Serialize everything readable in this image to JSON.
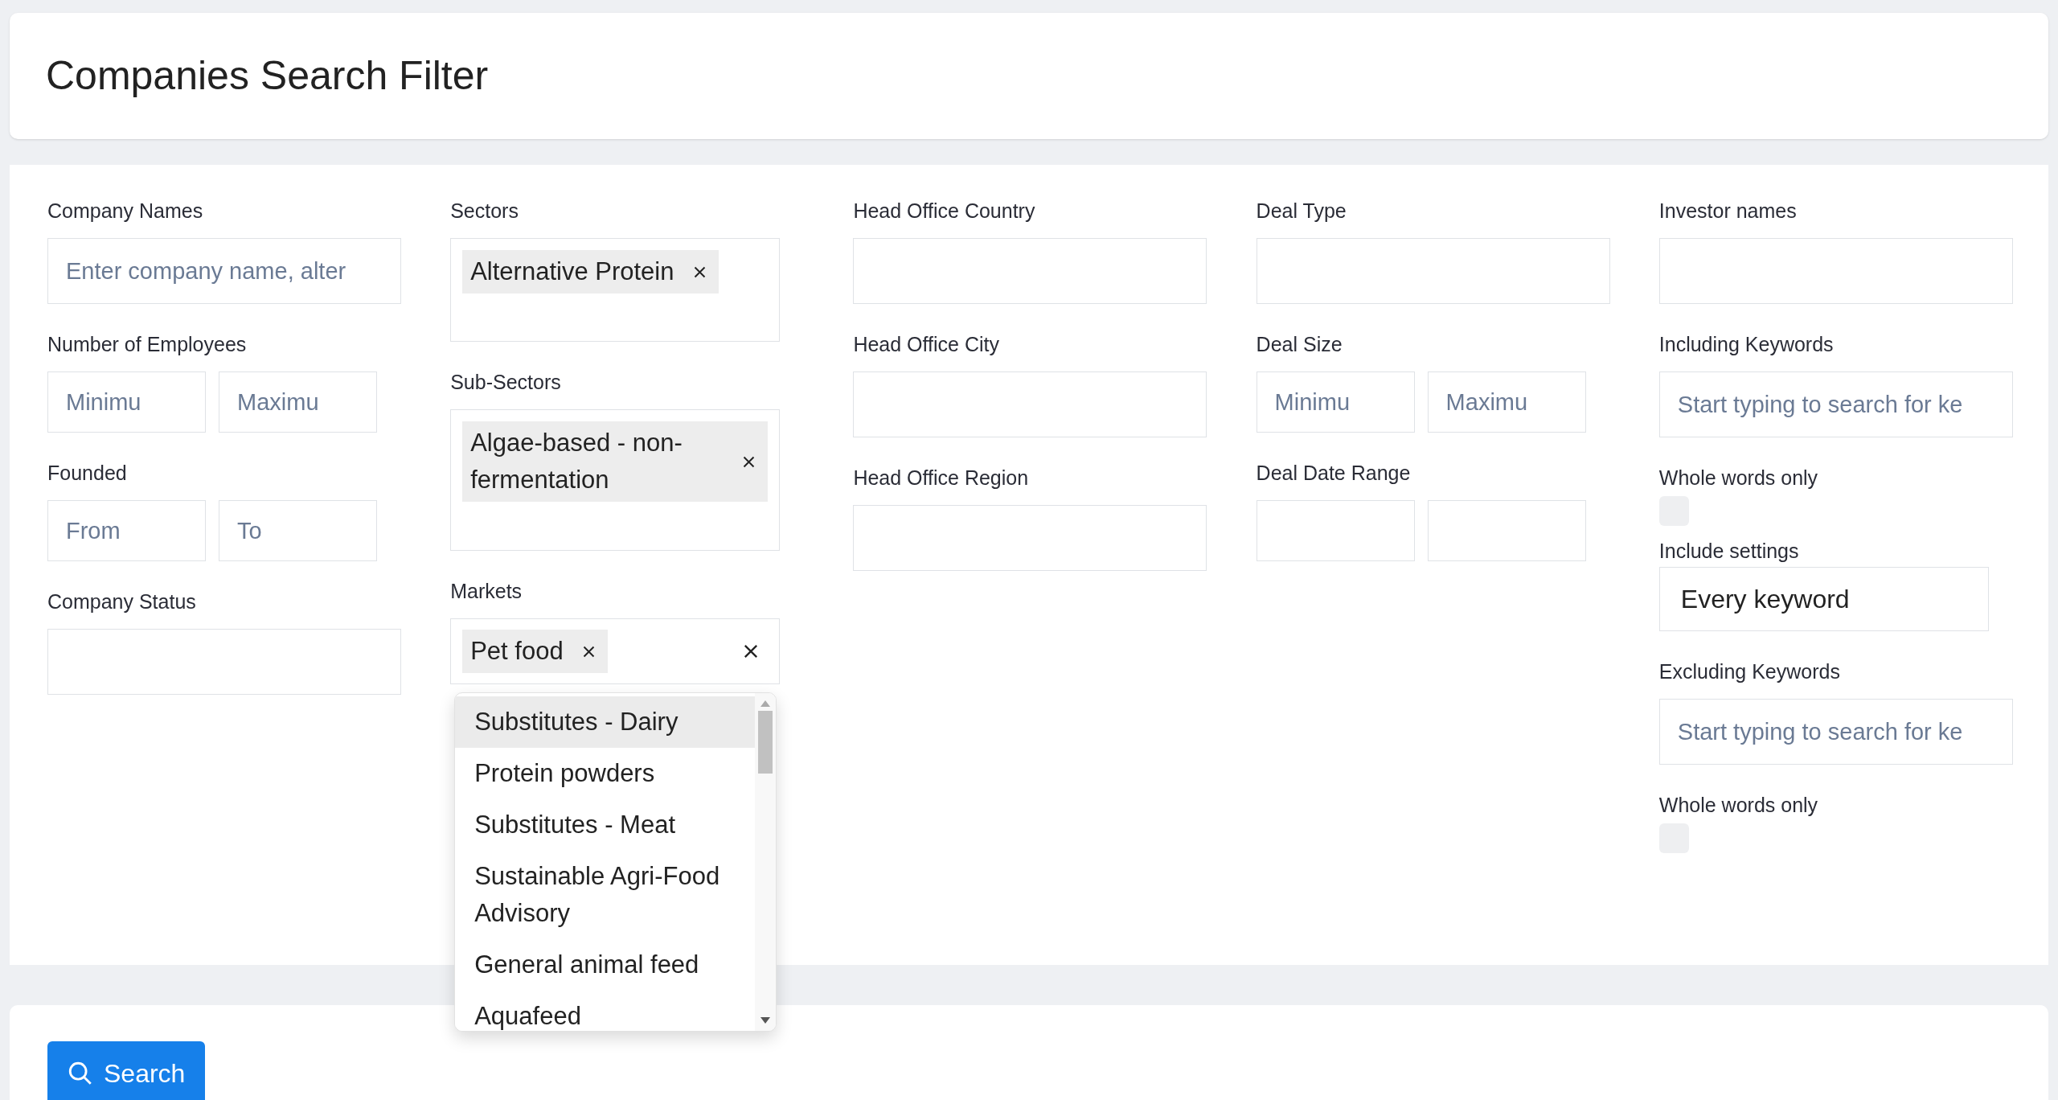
{
  "header": {
    "title": "Companies Search Filter"
  },
  "columns": [
    [
      {
        "kind": "input",
        "label": "Company Names",
        "placeholder": "Enter company name, alter"
      },
      {
        "kind": "range",
        "label": "Number of Employees",
        "placeholders": [
          "Minimu",
          "Maximu"
        ]
      },
      {
        "kind": "range",
        "label": "Founded",
        "placeholders": [
          "From",
          "To"
        ]
      },
      {
        "kind": "input",
        "label": "Company Status"
      }
    ],
    [
      {
        "kind": "tags",
        "label": "Sectors",
        "tags": [
          "Alternative Protein"
        ],
        "clearable": false
      },
      {
        "kind": "tags",
        "label": "Sub-Sectors",
        "tags": [
          "Algae-based - non-fermentation"
        ],
        "clearable": false
      },
      {
        "kind": "tags",
        "label": "Markets",
        "tags": [
          "Pet food"
        ],
        "clearable": true,
        "dropdown": [
          {
            "label": "Substitutes - Dairy",
            "selected": true
          },
          {
            "label": "Protein powders",
            "selected": false
          },
          {
            "label": "Substitutes - Meat",
            "selected": false
          },
          {
            "label": "Sustainable Agri-Food Advisory",
            "selected": false
          },
          {
            "label": "General animal feed",
            "selected": false
          },
          {
            "label": "Aquafeed",
            "selected": false
          }
        ]
      }
    ],
    [
      {
        "kind": "input",
        "label": "Head Office Country"
      },
      {
        "kind": "input",
        "label": "Head Office City"
      },
      {
        "kind": "input",
        "label": "Head Office Region"
      }
    ],
    [
      {
        "kind": "input",
        "label": "Deal Type"
      },
      {
        "kind": "range",
        "label": "Deal Size",
        "placeholders": [
          "Minimu",
          "Maximu"
        ]
      },
      {
        "kind": "range",
        "label": "Deal Date Range"
      }
    ],
    [
      {
        "kind": "input",
        "label": "Investor names"
      },
      {
        "kind": "input",
        "label": "Including Keywords",
        "placeholder": "Start typing to search for ke"
      },
      {
        "kind": "checkbox",
        "label": "Whole words only",
        "checked": false
      },
      {
        "kind": "select",
        "label": "Include settings",
        "value": "Every keyword"
      },
      {
        "kind": "input",
        "label": "Excluding Keywords",
        "placeholder": "Start typing to search for ke"
      },
      {
        "kind": "checkbox",
        "label": "Whole words only",
        "checked": false
      }
    ]
  ],
  "search_button": {
    "label": "Search"
  }
}
